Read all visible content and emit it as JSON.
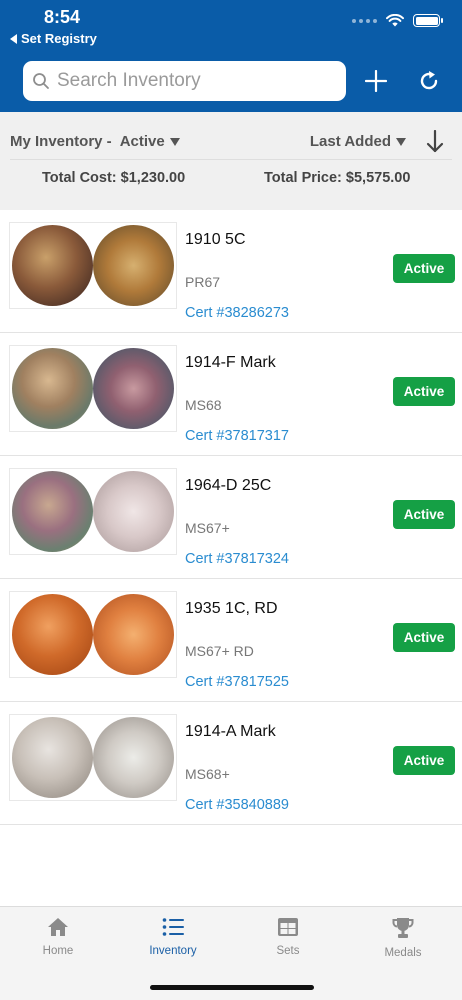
{
  "status_bar": {
    "time": "8:54",
    "back_label": "Set Registry"
  },
  "search": {
    "placeholder": "Search Inventory"
  },
  "header": {
    "add_icon": "plus-icon",
    "refresh_icon": "refresh-icon"
  },
  "filter": {
    "inventory_label": "My Inventory -",
    "status_value": "Active",
    "sort_label": "Last Added",
    "total_cost": "Total Cost: $1,230.00",
    "total_price": "Total Price: $5,575.00"
  },
  "items": [
    {
      "title": "1910 5C",
      "grade": "PR67",
      "cert": "Cert #38286273",
      "status": "Active"
    },
    {
      "title": "1914-F Mark",
      "grade": "MS68",
      "cert": "Cert #37817317",
      "status": "Active"
    },
    {
      "title": "1964-D 25C",
      "grade": "MS67+",
      "cert": "Cert #37817324",
      "status": "Active"
    },
    {
      "title": "1935 1C, RD",
      "grade": "MS67+ RD",
      "cert": "Cert #37817525",
      "status": "Active"
    },
    {
      "title": "1914-A Mark",
      "grade": "MS68+",
      "cert": "Cert #35840889",
      "status": "Active"
    }
  ],
  "tabs": [
    {
      "label": "Home",
      "icon": "home-icon"
    },
    {
      "label": "Inventory",
      "icon": "list-icon",
      "active": true
    },
    {
      "label": "Sets",
      "icon": "grid-icon"
    },
    {
      "label": "Medals",
      "icon": "trophy-icon"
    }
  ],
  "colors": {
    "header_blue": "#0a5ca8",
    "badge_green": "#15a045",
    "link_blue": "#2a8cd0",
    "tab_active": "#1a5fa6"
  }
}
